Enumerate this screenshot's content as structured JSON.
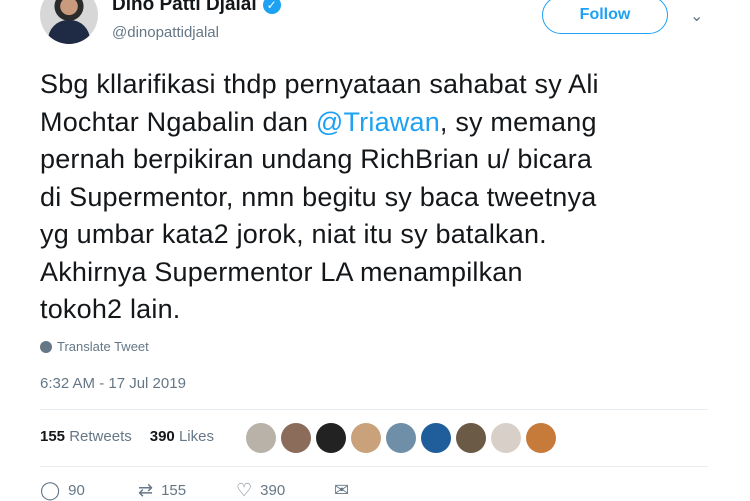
{
  "user": {
    "name": "Dino Patti Djalal",
    "handle": "@dinopattidjalal",
    "verified_symbol": "✓"
  },
  "follow_label": "Follow",
  "tweet": {
    "text_before": "Sbg kllarifikasi thdp pernyataan sahabat sy Ali\nMochtar Ngabalin dan ",
    "mention": "@Triawan",
    "text_after": ", sy memang\npernah berpikiran undang RichBrian u/ bicara\ndi Supermentor, nmn begitu sy baca tweetnya\nyg umbar kata2 jorok, niat itu sy batalkan.\nAkhirnya Supermentor LA menampilkan\ntokoh2 lain."
  },
  "translate_label": "Translate Tweet",
  "timestamp": "6:32 AM - 17 Jul 2019",
  "stats": {
    "retweets_count": "155",
    "retweets_label": "Retweets",
    "likes_count": "390",
    "likes_label": "Likes"
  },
  "likers_colors": [
    "#b8b2a8",
    "#8b6b5a",
    "#222222",
    "#c9a27c",
    "#6f8fa8",
    "#1f5d9b",
    "#6b5a45",
    "#d8d0c8",
    "#c77b3a"
  ],
  "actions": {
    "reply_count": "90",
    "retweet_count": "155",
    "like_count": "390"
  },
  "icons": {
    "reply": "reply-icon",
    "retweet": "retweet-icon",
    "like": "heart-icon",
    "message": "mail-icon",
    "globe": "globe-icon",
    "chevron": "chevron-down-icon"
  }
}
